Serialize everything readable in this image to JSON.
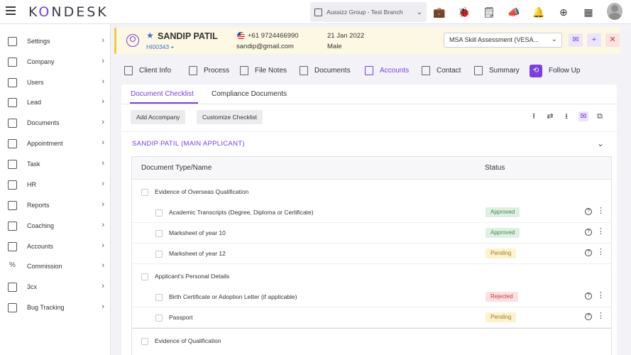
{
  "app": {
    "logo_prefix": "K",
    "logo_accent": "O",
    "logo_suffix": "NDESK",
    "branch": "Aussizz Group - Test Branch"
  },
  "top_icons": [
    "briefcase-icon",
    "bug-icon",
    "note-icon",
    "megaphone-icon",
    "bell-icon",
    "plus-circle-icon",
    "apps-grid-icon"
  ],
  "sidebar": {
    "items": [
      {
        "label": "Settings",
        "icon": "gear-icon"
      },
      {
        "label": "Company",
        "icon": "building-icon"
      },
      {
        "label": "Users",
        "icon": "users-icon"
      },
      {
        "label": "Lead",
        "icon": "lead-icon"
      },
      {
        "label": "Documents",
        "icon": "documents-icon"
      },
      {
        "label": "Appointment",
        "icon": "appointment-icon"
      },
      {
        "label": "Task",
        "icon": "task-icon"
      },
      {
        "label": "HR",
        "icon": "hr-icon"
      },
      {
        "label": "Reports",
        "icon": "reports-icon"
      },
      {
        "label": "Coaching",
        "icon": "coaching-icon"
      },
      {
        "label": "Accounts",
        "icon": "accounts-icon"
      },
      {
        "label": "Commission",
        "icon": "percent-icon"
      },
      {
        "label": "3cx",
        "icon": "phone-icon"
      },
      {
        "label": "Bug Tracking",
        "icon": "bug-icon"
      }
    ]
  },
  "customer": {
    "name": "SANDIP PATIL",
    "id": "HI00343",
    "phone": "+61 9724466990",
    "email": "sandip@gmail.com",
    "date": "21 Jan 2022",
    "gender": "Male",
    "service": "MSA Skill Assessment (VESA..."
  },
  "tabs": [
    "Client Info",
    "Process",
    "File Notes",
    "Documents",
    "Accounts",
    "Contact",
    "Summary",
    "Follow Up"
  ],
  "active_tab": "Accounts",
  "subtabs": [
    "Document Checklist",
    "Compliance Documents"
  ],
  "buttons": {
    "add_accompany": "Add Accompany",
    "customize_checklist": "Customize Checklist"
  },
  "applicant_header": "SANDIP PATIL  (MAIN APPLICANT)",
  "table": {
    "col_doc": "Document Type/Name",
    "col_status": "Status",
    "groups": [
      {
        "title": "Evidence of Overseas Qualification",
        "items": [
          {
            "name": "Academic Transcripts (Degree, Diploma or Certificate)",
            "status": "Approved"
          },
          {
            "name": "Marksheet of year 10",
            "status": "Approved"
          },
          {
            "name": "Marksheet of year 12",
            "status": "Pending"
          }
        ]
      },
      {
        "title": "Applicant's Personal Details",
        "items": [
          {
            "name": "Birth Certificate or Adoption Letter (if applicable)",
            "status": "Rejected"
          },
          {
            "name": "Passport",
            "status": "Pending"
          }
        ]
      },
      {
        "title": "Evidence of Qualification",
        "items": []
      }
    ]
  },
  "colors": {
    "accent": "#7b3fe4",
    "approved": "#3f8a4e",
    "pending": "#9a7c1d",
    "rejected": "#c43c3c"
  }
}
